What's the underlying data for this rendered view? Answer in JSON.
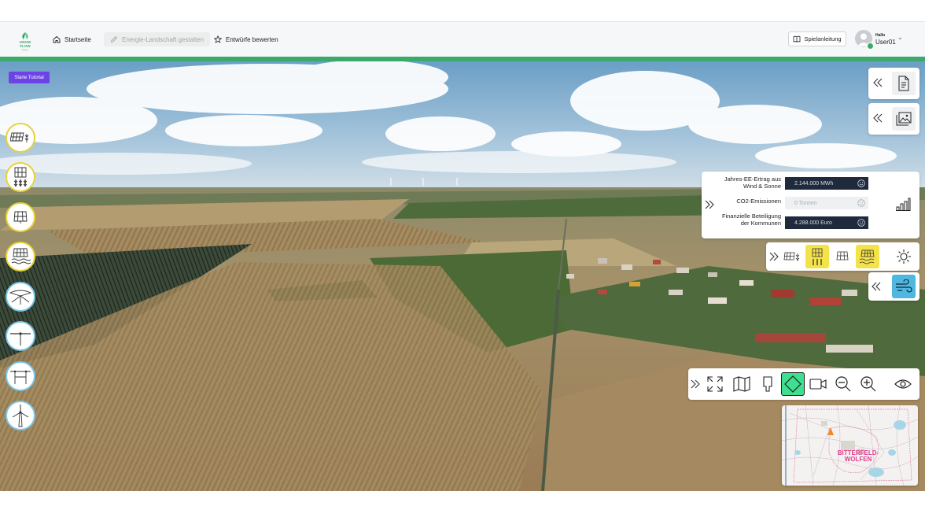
{
  "logo": {
    "icon": "growflow-logo",
    "text": "GROW FLOW PVT"
  },
  "nav": {
    "home": "Startseite",
    "design": "Energie-Landschaft gestalten",
    "rate": "Entwürfe bewerten"
  },
  "help": "Spielanleitung",
  "user": {
    "greeting": "Hallo",
    "name": "User01"
  },
  "tutorial": "Starte Tutorial",
  "tools": [
    {
      "icon": "agri-pv-crops-icon",
      "ring": "#e8d23a"
    },
    {
      "icon": "agri-pv-vertical-icon",
      "ring": "#e8d23a"
    },
    {
      "icon": "solar-panel-icon",
      "ring": "#e8d23a"
    },
    {
      "icon": "floating-pv-icon",
      "ring": "#e8d23a"
    },
    {
      "icon": "wind-rotor-icon",
      "ring": "#7cc4e6"
    },
    {
      "icon": "small-wind-turbine-icon",
      "ring": "#7cc4e6"
    },
    {
      "icon": "wind-turbine-pair-icon",
      "ring": "#7cc4e6"
    },
    {
      "icon": "large-wind-turbine-icon",
      "ring": "#7cc4e6"
    }
  ],
  "stats": {
    "yield_label": "Jahres-EE-Ertrag aus Wind & Sonne",
    "yield_value": "2.144.000 MWh",
    "co2_label": "CO2-Emissionen",
    "co2_value": "0 Tonnen",
    "finance_label": "Finanzielle Beteiligung der Kommunen",
    "finance_value": "4.288.000 Euro"
  },
  "minimap": {
    "label": "BITTERFELD-WOLFEN"
  },
  "colors": {
    "accent_green": "#3aa96b",
    "tutorial_purple": "#6d43e8",
    "highlight_yellow": "#f3e24a",
    "wind_blue": "#4fb7e0",
    "nav_active": "#3ee08f"
  }
}
